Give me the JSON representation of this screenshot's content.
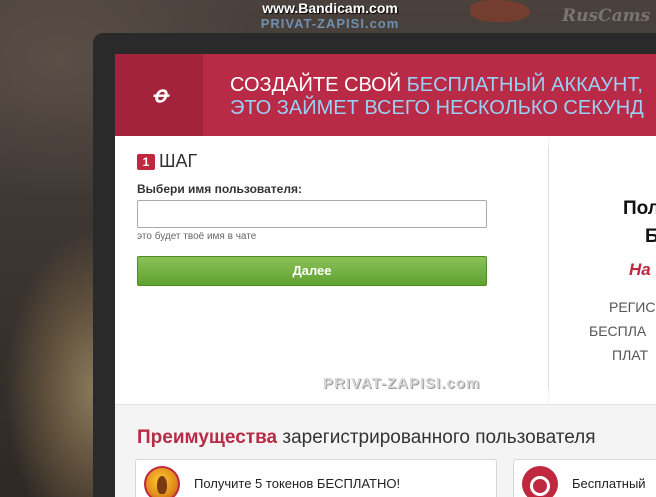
{
  "overlay": {
    "recorder_top": "www.Bandicam.com",
    "recorder_bottom": "PRIVAT-ZAPISI.com",
    "brand_right": "RusCams",
    "watermark_mid": "PRIVAT-ZAPISI.com"
  },
  "header": {
    "logo_text": "ꝋ",
    "line1_white": "СОЗДАЙТЕ СВОЙ ",
    "line1_blue": "БЕСПЛАТНЫЙ АККАУНТ,",
    "line2_blue": "ЭТО ЗАЙМЕТ ВСЕГО НЕСКОЛЬКО СЕКУНД"
  },
  "form": {
    "step_number": "1",
    "step_label": "ШАГ",
    "username_label": "Выбери имя пользователя:",
    "username_value": "",
    "username_placeholder": "",
    "hint": "это будет твоё имя в чате",
    "next_button": "Далее"
  },
  "right_column": {
    "title_line1": "Пол",
    "title_line2": "Б",
    "red_text": "На",
    "line_a": "РЕГИС",
    "line_b": "БЕСПЛА",
    "line_c": "ПЛАТ"
  },
  "benefits": {
    "title_strong": "Преимущества",
    "title_rest": " зарегистрированного пользователя",
    "cards": [
      {
        "icon": "token-icon",
        "text": "Получите 5 токенов БЕСПЛАТНО!"
      },
      {
        "icon": "key-icon",
        "text": "Бесплатный"
      }
    ]
  },
  "colors": {
    "header_bg": "#b92a46",
    "logo_box_bg": "#a3233d",
    "header_highlight": "#9bd0f5",
    "button_green": "#6aae3b",
    "accent_red": "#c0283f"
  }
}
